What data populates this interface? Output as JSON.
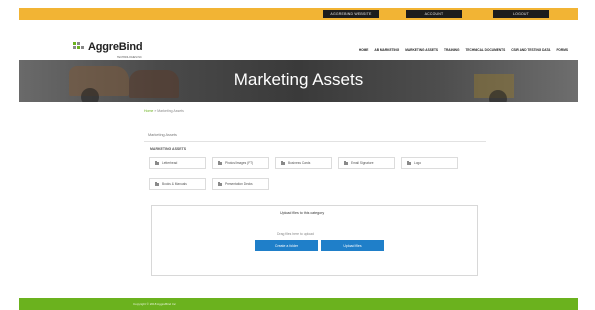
{
  "topbar": {
    "buttons": [
      "AGGREBIND WEBSITE",
      "ACCOUNT",
      "LOGOUT"
    ]
  },
  "brand": {
    "name": "AggreBind",
    "tagline": "TECHNOLOGIES INC"
  },
  "nav": {
    "items": [
      "HOME",
      "AB MARKETING",
      "MARKETING ASSETS",
      "TRAINING",
      "TECHNICAL DOCUMENTS",
      "CSIR AND TESTING DATA",
      "FORMS"
    ]
  },
  "hero": {
    "title": "Marketing Assets"
  },
  "breadcrumb": {
    "home": "Home",
    "separator": " » ",
    "current": "Marketing Assets"
  },
  "panel": {
    "title": "Marketing Assets",
    "section_label": "MARKETING ASSETS",
    "folders": [
      "Letterhead",
      "Photos/Images (FT)",
      "Business Cards",
      "Email Signature",
      "Logo",
      "Books & Manuals",
      "Presentation Decks"
    ]
  },
  "upload": {
    "heading": "Upload files to this category",
    "hint": "Drag files here to upload",
    "button_create": "Create a folder",
    "button_upload": "Upload files"
  },
  "footer": {
    "text": "Copyright © 2018 AggreBind Inc"
  },
  "colors": {
    "topbar": "#f2b434",
    "accent": "#6bb21e",
    "button": "#1f7fc9",
    "hero_text": "#ffffff"
  }
}
